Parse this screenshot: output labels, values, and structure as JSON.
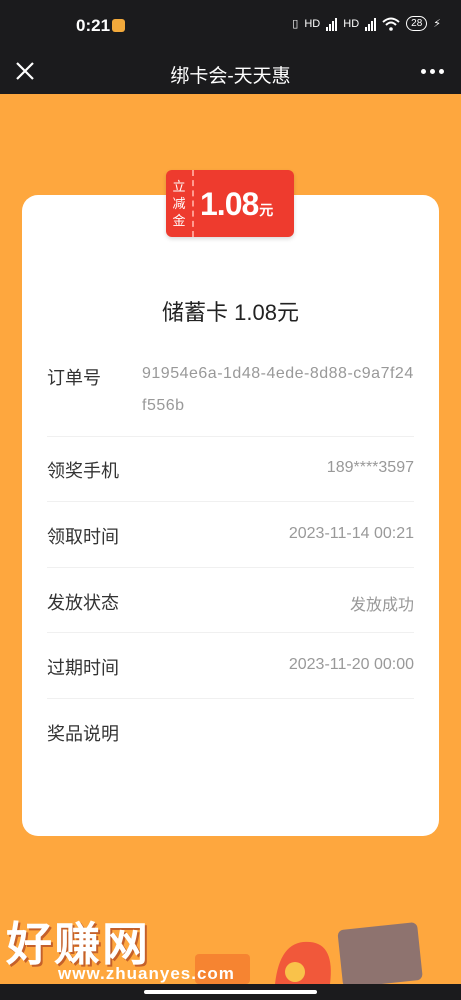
{
  "status_bar": {
    "time": "0:21",
    "network_labels": [
      "HD",
      "HD"
    ],
    "battery": "28"
  },
  "title_bar": {
    "title": "绑卡会-天天惠"
  },
  "coupon": {
    "tag_chars": [
      "立",
      "减",
      "金"
    ],
    "amount": "1.08",
    "unit": "元"
  },
  "card": {
    "title": "储蓄卡 1.08元",
    "rows": [
      {
        "label": "订单号",
        "value": "91954e6a-1d48-4ede-8d88-c9a7f24f556b"
      },
      {
        "label": "领奖手机",
        "value": "189****3597"
      },
      {
        "label": "领取时间",
        "value": "2023-11-14 00:21"
      },
      {
        "label": "发放状态",
        "value": "发放成功"
      },
      {
        "label": "过期时间",
        "value": "2023-11-20 00:00"
      },
      {
        "label": "奖品说明",
        "value": ""
      }
    ]
  },
  "watermark": {
    "text": "好赚网",
    "url": "www.zhuanyes.com"
  },
  "colors": {
    "page_bg": "#fea73e",
    "badge_red": "#ee3b2e",
    "bar_dark": "#1b1b1d"
  }
}
